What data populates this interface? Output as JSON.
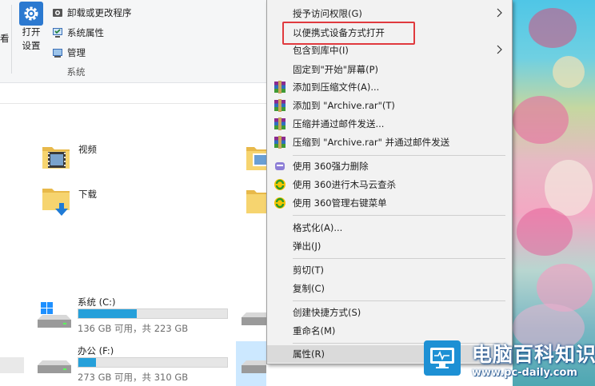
{
  "ribbon": {
    "left_cut_label": "看",
    "open_settings_label_1": "打开",
    "open_settings_label_2": "设置",
    "items": [
      {
        "label": "卸载或更改程序",
        "icon": "uninstall-icon"
      },
      {
        "label": "系统属性",
        "icon": "system-properties-icon"
      },
      {
        "label": "管理",
        "icon": "manage-icon"
      }
    ],
    "group_label": "系统"
  },
  "folders": [
    {
      "label": "视频",
      "icon": "video-folder-icon"
    },
    {
      "label": "下载",
      "icon": "download-folder-icon"
    }
  ],
  "drives": [
    {
      "name": "系统 (C:)",
      "size": "136 GB 可用，共 223 GB",
      "used_fraction": 0.39
    },
    {
      "name": "办公 (F:)",
      "size": "273 GB 可用，共 310 GB",
      "used_fraction": 0.12
    }
  ],
  "context_menu": {
    "items": [
      {
        "label": "授予访问权限(G)",
        "icon": "",
        "submenu": true
      },
      {
        "label": "以便携式设备方式打开",
        "icon": "",
        "submenu": false
      },
      {
        "label": "包含到库中(I)",
        "icon": "",
        "submenu": true
      },
      {
        "label": "固定到\"开始\"屏幕(P)",
        "icon": "",
        "submenu": false
      },
      {
        "label": "添加到压缩文件(A)...",
        "icon": "winrar-icon",
        "submenu": false
      },
      {
        "label": "添加到 \"Archive.rar\"(T)",
        "icon": "winrar-icon",
        "submenu": false
      },
      {
        "label": "压缩并通过邮件发送...",
        "icon": "winrar-icon",
        "submenu": false
      },
      {
        "label": "压缩到 \"Archive.rar\" 并通过邮件发送",
        "icon": "winrar-icon",
        "submenu": false
      },
      {
        "label": "使用 360强力删除",
        "icon": "shredder-360-icon",
        "submenu": false
      },
      {
        "label": "使用 360进行木马云查杀",
        "icon": "antivirus-360-icon",
        "submenu": false
      },
      {
        "label": "使用 360管理右键菜单",
        "icon": "antivirus-360-icon",
        "submenu": false
      },
      {
        "label": "格式化(A)...",
        "icon": "",
        "submenu": false
      },
      {
        "label": "弹出(J)",
        "icon": "",
        "submenu": false
      },
      {
        "label": "剪切(T)",
        "icon": "",
        "submenu": false
      },
      {
        "label": "复制(C)",
        "icon": "",
        "submenu": false
      },
      {
        "label": "创建快捷方式(S)",
        "icon": "",
        "submenu": false
      },
      {
        "label": "重命名(M)",
        "icon": "",
        "submenu": false
      },
      {
        "label": "属性(R)",
        "icon": "",
        "submenu": false
      }
    ]
  },
  "watermark": {
    "title": "电脑百科知识",
    "url": "www.pc-daily.com"
  },
  "colors": {
    "accent_blue": "#26a0da",
    "highlight_red": "#e03a3e",
    "menu_bg": "#f2f2f2"
  }
}
